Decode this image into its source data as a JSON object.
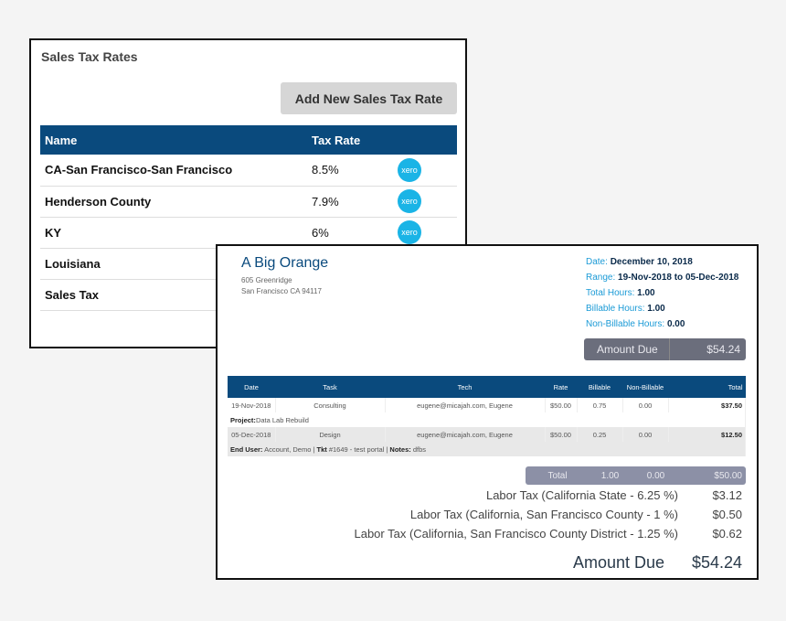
{
  "tax_panel": {
    "title": "Sales Tax Rates",
    "add_button": "Add New Sales Tax Rate",
    "columns": [
      "Name",
      "Tax Rate"
    ],
    "rows": [
      {
        "name": "CA-San Francisco-San Francisco",
        "rate": "8.5%",
        "xero": true
      },
      {
        "name": "Henderson County",
        "rate": "7.9%",
        "xero": true
      },
      {
        "name": "KY",
        "rate": "6%",
        "xero": true
      },
      {
        "name": "Louisiana",
        "rate": "",
        "xero": false
      },
      {
        "name": "Sales Tax",
        "rate": "",
        "xero": false
      }
    ],
    "xero_label": "xero"
  },
  "invoice": {
    "company": "A Big Orange",
    "address1": "605 Greenridge",
    "address2": "San Francisco CA 94117",
    "meta": [
      {
        "label": "Date:",
        "value": "December 10, 2018"
      },
      {
        "label": "Range:",
        "value": "19-Nov-2018 to 05-Dec-2018"
      },
      {
        "label": "Total Hours:",
        "value": "1.00"
      },
      {
        "label": "Billable Hours:",
        "value": "1.00"
      },
      {
        "label": "Non-Billable Hours:",
        "value": "0.00"
      }
    ],
    "amount_due_label": "Amount Due",
    "amount_due": "$54.24",
    "columns": [
      "Date",
      "Task",
      "Tech",
      "Rate",
      "Billable",
      "Non-Billable",
      "Total"
    ],
    "rows": [
      {
        "date": "19-Nov-2018",
        "task": "Consulting",
        "tech": "eugene@micajah.com, Eugene",
        "rate": "$50.00",
        "billable": "0.75",
        "nonbillable": "0.00",
        "total": "$37.50"
      },
      {
        "date": "05-Dec-2018",
        "task": "Design",
        "tech": "eugene@micajah.com, Eugene",
        "rate": "$50.00",
        "billable": "0.25",
        "nonbillable": "0.00",
        "total": "$12.50"
      }
    ],
    "note1_label": "Project:",
    "note1_value": "Data Lab Rebuild",
    "note2": {
      "eu_label": "End User:",
      "eu": " Account, Demo | ",
      "tkt_label": "Tkt",
      "tkt": " #1649 - test portal | ",
      "notes_label": "Notes:",
      "notes": " dfbs"
    },
    "totals": {
      "label": "Total",
      "billable": "1.00",
      "nonbillable": "0.00",
      "total": "$50.00"
    },
    "taxes": [
      {
        "label": "Labor Tax (California State - 6.25 %)",
        "value": "$3.12"
      },
      {
        "label": "Labor Tax (California, San Francisco County - 1 %)",
        "value": "$0.50"
      },
      {
        "label": "Labor Tax (California, San Francisco County District - 1.25 %)",
        "value": "$0.62"
      }
    ],
    "final_label": "Amount Due",
    "final_value": "$54.24"
  }
}
